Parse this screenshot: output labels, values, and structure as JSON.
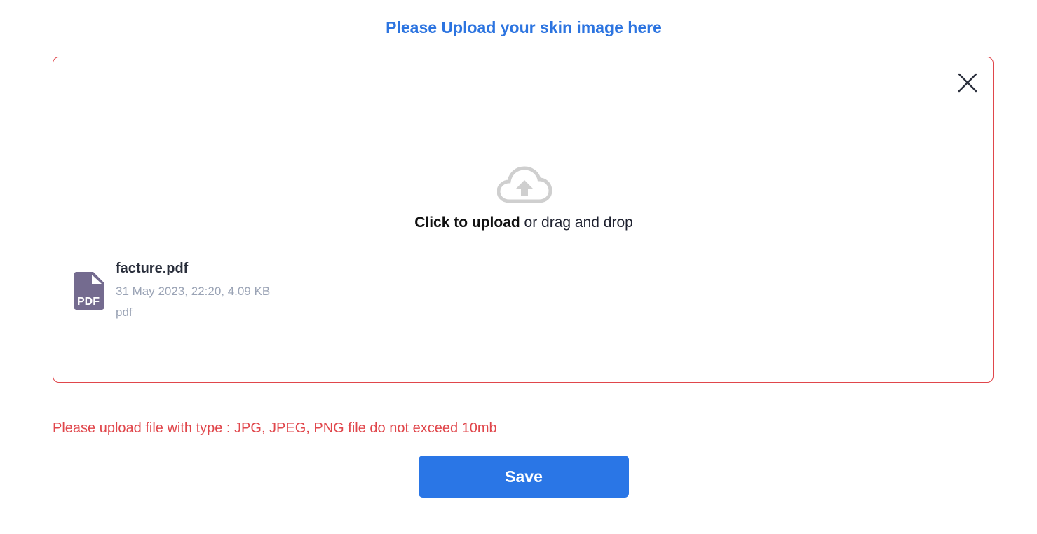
{
  "header": {
    "title": "Please Upload your skin image here"
  },
  "dropzone": {
    "click_label": "Click to upload",
    "drag_label": " or drag and drop",
    "cloud_icon": "cloud-upload-icon",
    "close_icon": "close-icon"
  },
  "file": {
    "name": "facture.pdf",
    "meta": "31 May 2023, 22:20, 4.09 KB",
    "type": "pdf",
    "icon_label": "PDF",
    "icon": "pdf-file-icon"
  },
  "error": {
    "message": "Please upload file with type : JPG, JPEG, PNG file do not exceed 10mb"
  },
  "actions": {
    "save_label": "Save"
  },
  "colors": {
    "title": "#2c74e0",
    "border_error": "#e0464b",
    "primary": "#2a76e6",
    "muted": "#9aa3b5",
    "pdf_icon": "#746b8f"
  }
}
